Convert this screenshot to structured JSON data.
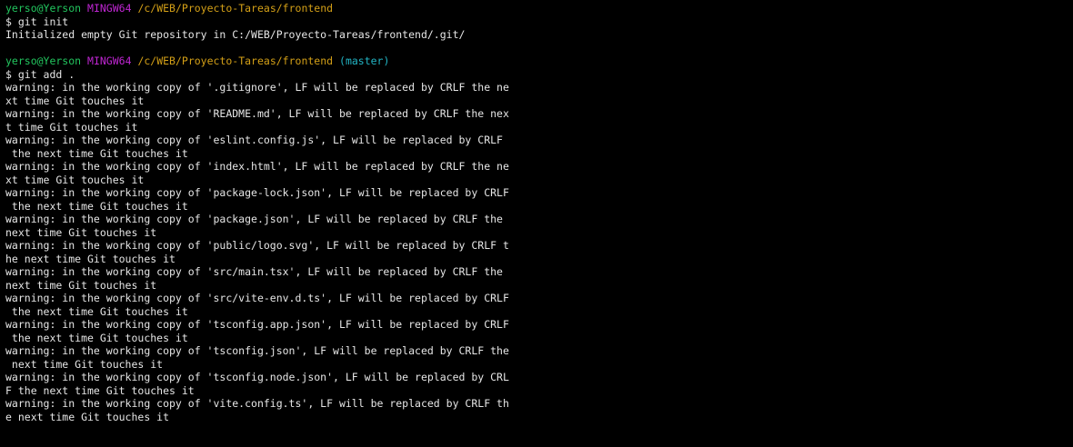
{
  "prompt_blocks": [
    {
      "user": "yerso@Yerson",
      "host": "MINGW64",
      "path": "/c/WEB/Proyecto-Tareas/frontend",
      "branch": "",
      "command": "$ git init",
      "output": [
        "Initialized empty Git repository in C:/WEB/Proyecto-Tareas/frontend/.git/"
      ]
    },
    {
      "user": "yerso@Yerson",
      "host": "MINGW64",
      "path": "/c/WEB/Proyecto-Tareas/frontend",
      "branch": "(master)",
      "command": "$ git add .",
      "output": [
        "warning: in the working copy of '.gitignore', LF will be replaced by CRLF the ne",
        "xt time Git touches it",
        "warning: in the working copy of 'README.md', LF will be replaced by CRLF the nex",
        "t time Git touches it",
        "warning: in the working copy of 'eslint.config.js', LF will be replaced by CRLF",
        " the next time Git touches it",
        "warning: in the working copy of 'index.html', LF will be replaced by CRLF the ne",
        "xt time Git touches it",
        "warning: in the working copy of 'package-lock.json', LF will be replaced by CRLF",
        " the next time Git touches it",
        "warning: in the working copy of 'package.json', LF will be replaced by CRLF the",
        "next time Git touches it",
        "warning: in the working copy of 'public/logo.svg', LF will be replaced by CRLF t",
        "he next time Git touches it",
        "warning: in the working copy of 'src/main.tsx', LF will be replaced by CRLF the",
        "next time Git touches it",
        "warning: in the working copy of 'src/vite-env.d.ts', LF will be replaced by CRLF",
        " the next time Git touches it",
        "warning: in the working copy of 'tsconfig.app.json', LF will be replaced by CRLF",
        " the next time Git touches it",
        "warning: in the working copy of 'tsconfig.json', LF will be replaced by CRLF the",
        " next time Git touches it",
        "warning: in the working copy of 'tsconfig.node.json', LF will be replaced by CRL",
        "F the next time Git touches it",
        "warning: in the working copy of 'vite.config.ts', LF will be replaced by CRLF th",
        "e next time Git touches it"
      ]
    }
  ],
  "colors": {
    "background": "#000000",
    "text": "#e6e6e6",
    "user": "#22c55e",
    "host": "#c026d3",
    "path": "#d4a017",
    "branch": "#22b5c5"
  }
}
